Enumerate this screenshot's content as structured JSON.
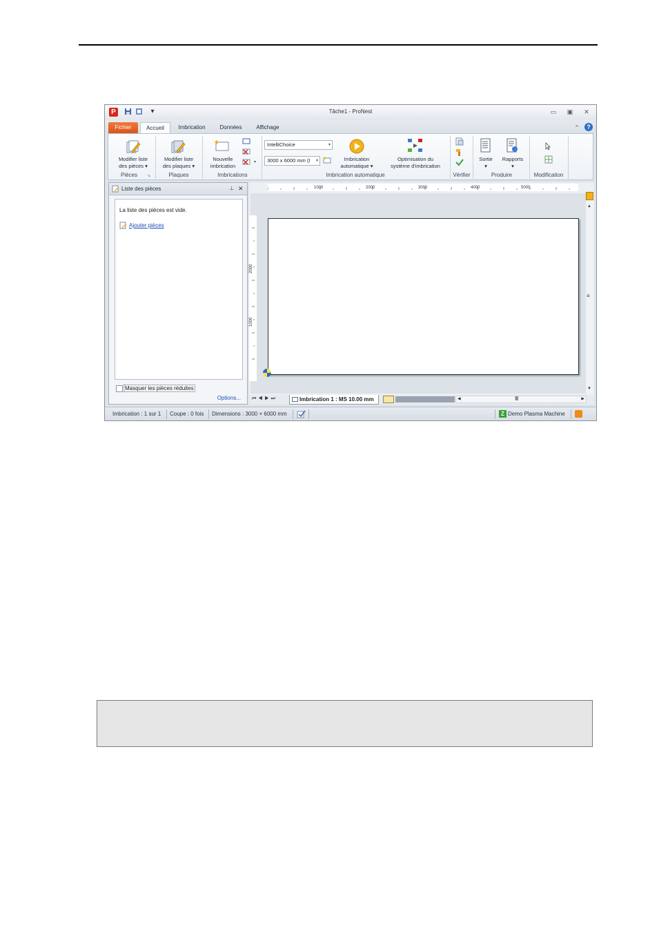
{
  "window": {
    "title": "Tâche1 - ProNest",
    "logo_letter": "P"
  },
  "tabs": [
    {
      "label": "Fichier"
    },
    {
      "label": "Accueil"
    },
    {
      "label": "Imbrication"
    },
    {
      "label": "Données"
    },
    {
      "label": "Affichage"
    }
  ],
  "ribbon": {
    "pieces": {
      "button_line1": "Modifier liste",
      "button_line2": "des pièces ▾",
      "group": "Pièces"
    },
    "plaques": {
      "button_line1": "Modifier liste",
      "button_line2": "des plaques ▾",
      "group": "Plaques"
    },
    "imbrications": {
      "button_line1": "Nouvelle",
      "button_line2": "imbrication",
      "group": "Imbrications"
    },
    "auto": {
      "combo_strategy": "IntelliChoice",
      "combo_plate": "3000 x 6000 mm (I",
      "button_line1": "Imbrication",
      "button_line2": "automatique ▾",
      "opt_line1": "Optimisation du",
      "opt_line2": "système d'imbrication",
      "group": "Imbrication automatique"
    },
    "verifier": {
      "group": "Vérifier"
    },
    "produire": {
      "sortie": "Sortie",
      "rapports": "Rapports",
      "group": "Produire"
    },
    "modification": {
      "group": "Modification"
    }
  },
  "panel": {
    "title": "Liste des pièces",
    "empty_message": "La liste des pièces est vide.",
    "add_link": "Ajouter pièces",
    "checkbox_label": "Masquer les pièces réduites",
    "options_link": "Options..."
  },
  "rulers": {
    "h_ticks": [
      "1000",
      "2000",
      "3000",
      "4000",
      "5000"
    ],
    "v_ticks": [
      "2000",
      "1000"
    ]
  },
  "sheet_tab": {
    "label": "Imbrication 1 : MS 10.00 mm"
  },
  "status": {
    "imbrication": "Imbrication : 1 sur 1",
    "coupe": "Coupe : 0 fois",
    "dimensions": "Dimensions : 3000 × 6000 mm",
    "machine": "Demo Plasma Machine"
  },
  "colors": {
    "file_tab": "#e0612a",
    "link": "#1a4fb5",
    "accent": "#f2b21a"
  }
}
